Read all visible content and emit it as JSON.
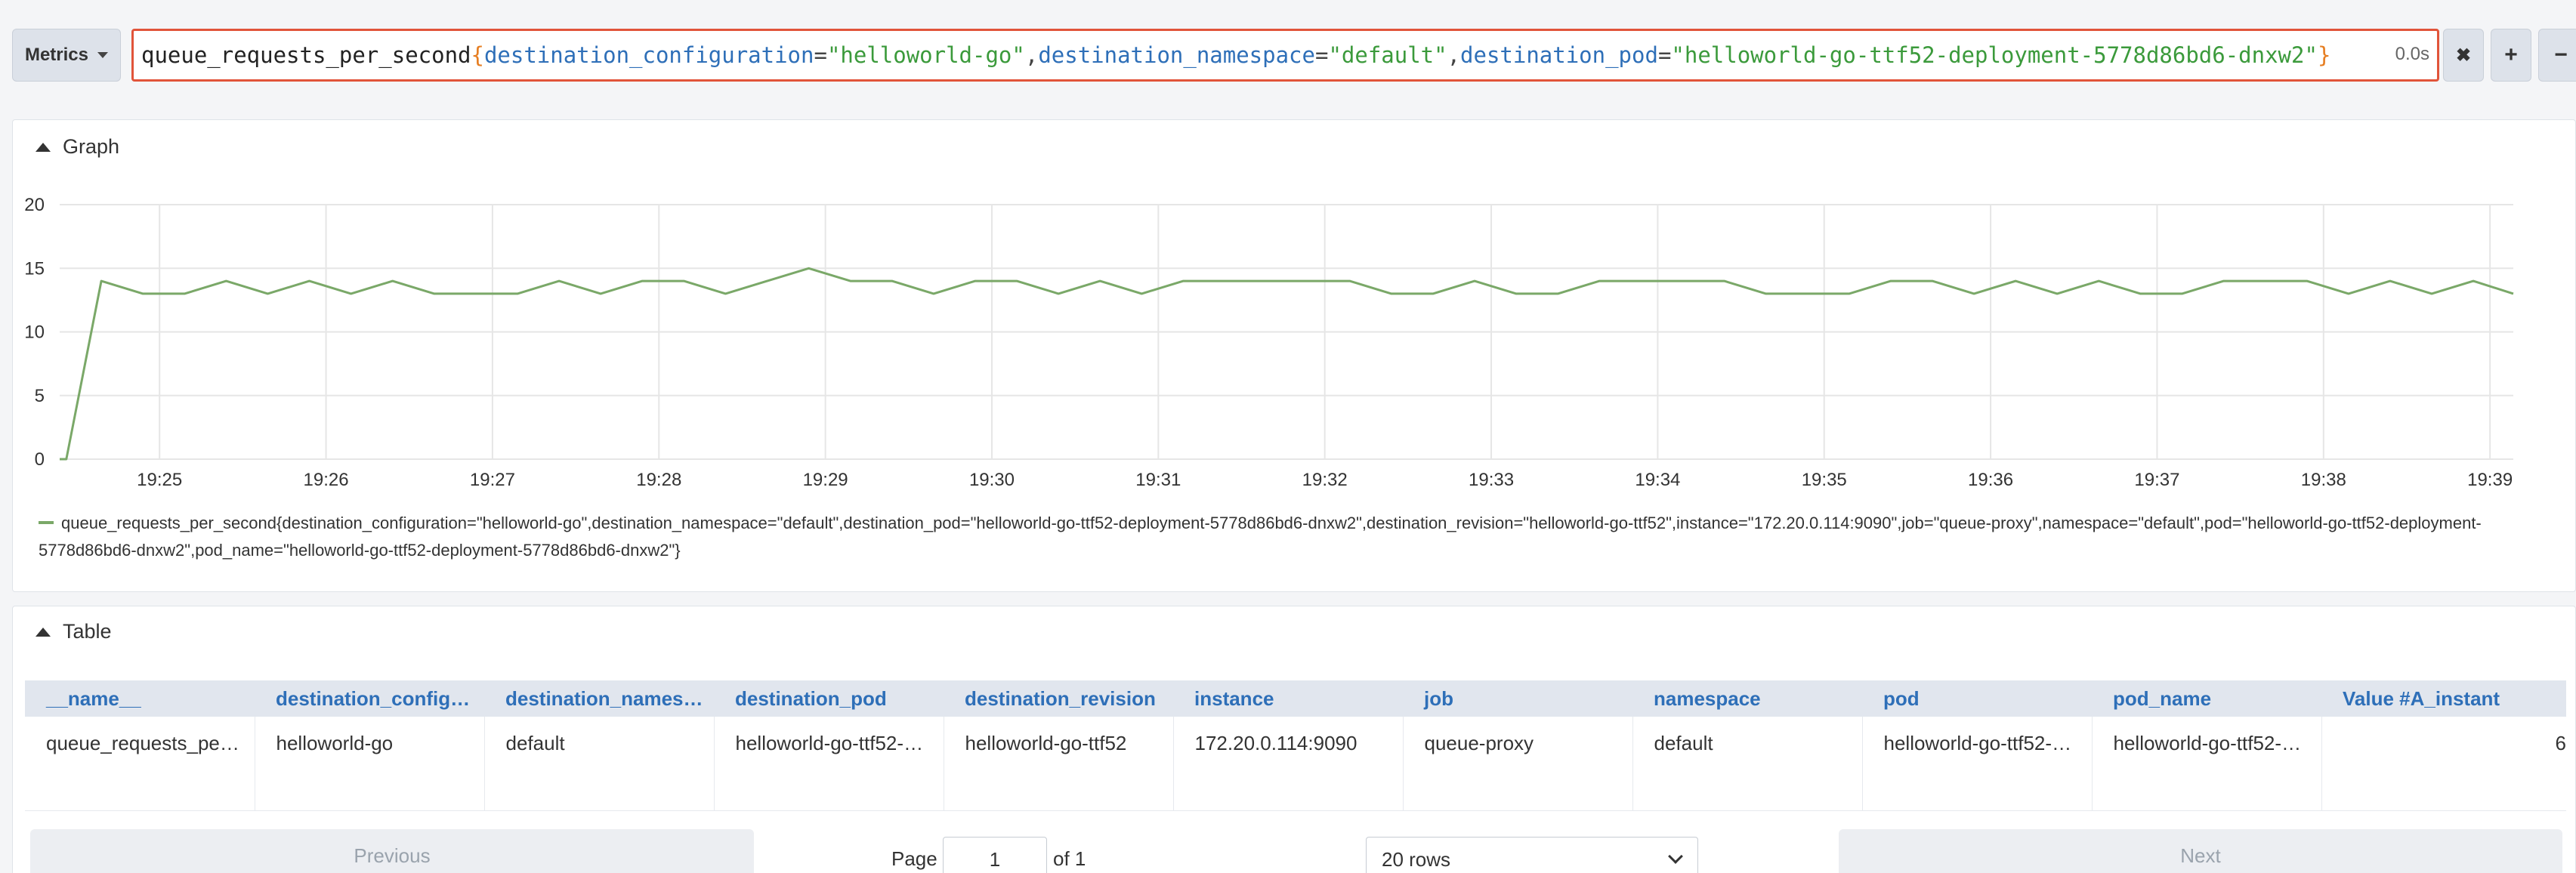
{
  "toolbar": {
    "metrics_label": "Metrics",
    "exec_time": "0.0s",
    "clear_symbol": "✖",
    "add_symbol": "+",
    "remove_symbol": "−"
  },
  "query": {
    "metric": "queue_requests_per_second",
    "open": "{",
    "close": "}",
    "pairs": [
      {
        "label": "destination_configuration",
        "value": "\"helloworld-go\""
      },
      {
        "label": "destination_namespace",
        "value": "\"default\""
      },
      {
        "label": "destination_pod",
        "value": "\"helloworld-go-ttf52-deployment-5778d86bd6-dnxw2\""
      }
    ]
  },
  "graph": {
    "heading": "Graph",
    "legend": "queue_requests_per_second{destination_configuration=\"helloworld-go\",destination_namespace=\"default\",destination_pod=\"helloworld-go-ttf52-deployment-5778d86bd6-dnxw2\",destination_revision=\"helloworld-go-ttf52\",instance=\"172.20.0.114:9090\",job=\"queue-proxy\",namespace=\"default\",pod=\"helloworld-go-ttf52-deployment-5778d86bd6-dnxw2\",pod_name=\"helloworld-go-ttf52-deployment-5778d86bd6-dnxw2\"}",
    "line_color": "#7aa868"
  },
  "chart_data": {
    "type": "line",
    "title": "",
    "xlabel": "",
    "ylabel": "",
    "ylim": [
      0,
      20
    ],
    "yticks": [
      0,
      5,
      10,
      15,
      20
    ],
    "xticks": [
      "19:25",
      "19:26",
      "19:27",
      "19:28",
      "19:29",
      "19:30",
      "19:31",
      "19:32",
      "19:33",
      "19:34",
      "19:35",
      "19:36",
      "19:37",
      "19:38",
      "19:39"
    ],
    "xrange_minutes": [
      19.4,
      34.14
    ],
    "grid": true,
    "legend_position": "bottom",
    "series": [
      {
        "name": "queue_requests_per_second{destination_configuration=\"helloworld-go\",destination_namespace=\"default\",destination_pod=\"helloworld-go-ttf52-deployment-5778d86bd6-dnxw2\",destination_revision=\"helloworld-go-ttf52\",instance=\"172.20.0.114:9090\",job=\"queue-proxy\",namespace=\"default\",pod=\"helloworld-go-ttf52-deployment-5778d86bd6-dnxw2\",pod_name=\"helloworld-go-ttf52-deployment-5778d86bd6-dnxw2\"}",
        "x_minutes": [
          19.4,
          19.44,
          19.65,
          19.9,
          20.15,
          20.4,
          20.65,
          20.9,
          21.15,
          21.4,
          21.65,
          21.9,
          22.15,
          22.4,
          22.65,
          22.9,
          23.15,
          23.4,
          23.65,
          23.9,
          24.15,
          24.4,
          24.65,
          24.9,
          25.15,
          25.4,
          25.65,
          25.9,
          26.15,
          26.4,
          26.65,
          26.9,
          27.15,
          27.4,
          27.65,
          27.9,
          28.15,
          28.4,
          28.65,
          28.9,
          29.15,
          29.4,
          29.65,
          29.9,
          30.15,
          30.4,
          30.65,
          30.9,
          31.15,
          31.4,
          31.65,
          31.9,
          32.15,
          32.4,
          32.65,
          32.9,
          33.15,
          33.4,
          33.65,
          33.9,
          34.14
        ],
        "values": [
          0,
          0,
          14,
          13,
          13,
          14,
          13,
          14,
          13,
          14,
          13,
          13,
          13,
          14,
          13,
          14,
          14,
          13,
          14,
          15,
          14,
          14,
          13,
          14,
          14,
          13,
          14,
          13,
          14,
          14,
          14,
          14,
          14,
          13,
          13,
          14,
          13,
          13,
          14,
          14,
          14,
          14,
          13,
          13,
          13,
          14,
          14,
          13,
          14,
          13,
          14,
          13,
          13,
          14,
          14,
          14,
          13,
          14,
          13,
          14,
          13
        ]
      }
    ]
  },
  "table": {
    "heading": "Table",
    "columns": [
      "__name__",
      "destination_configura…",
      "destination_namespace",
      "destination_pod",
      "destination_revision",
      "instance",
      "job",
      "namespace",
      "pod",
      "pod_name",
      "Value #A_instant"
    ],
    "rows": [
      [
        "queue_requests_per_…",
        "helloworld-go",
        "default",
        "helloworld-go-ttf52-de…",
        "helloworld-go-ttf52",
        "172.20.0.114:9090",
        "queue-proxy",
        "default",
        "helloworld-go-ttf52-de…",
        "helloworld-go-ttf52-de…",
        "6"
      ]
    ]
  },
  "pagination": {
    "previous": "Previous",
    "next": "Next",
    "page_label": "Page",
    "page_value": "1",
    "of_label": "of 1",
    "rows_select": "20 rows"
  }
}
